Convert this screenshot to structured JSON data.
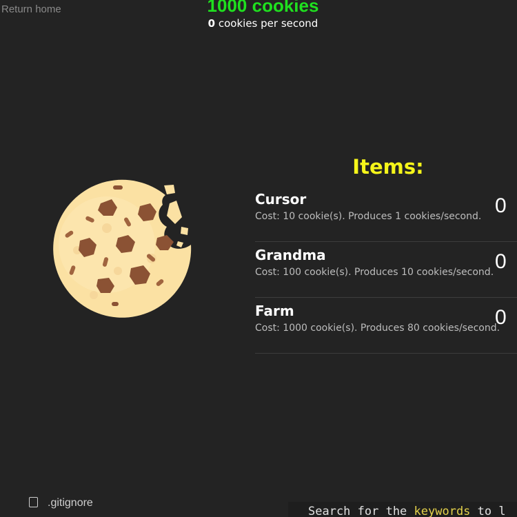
{
  "nav": {
    "return_home": "Return home"
  },
  "stats": {
    "cookies_text": "1000 cookies",
    "cps_value": "0",
    "cps_suffix": " cookies per second"
  },
  "items_title": "Items:",
  "items": [
    {
      "name": "Cursor",
      "desc": "Cost: 10 cookie(s). Produces 1 cookies/second.",
      "owned": "0"
    },
    {
      "name": "Grandma",
      "desc": "Cost: 100 cookie(s). Produces 10 cookies/second.",
      "owned": "0"
    },
    {
      "name": "Farm",
      "desc": "Cost: 1000 cookie(s). Produces 80 cookies/second.",
      "owned": "0"
    }
  ],
  "bottom": {
    "file_name": ".gitignore",
    "hint_part1": "Search for the ",
    "hint_keyword": "keywords",
    "hint_part2": " to l"
  },
  "colors": {
    "background": "#232323",
    "cookie_count": "#1fe01f",
    "items_title": "#f5f51a",
    "cookie_dough": "#fbe1a3",
    "cookie_chip": "#8b5234"
  },
  "icons": {
    "cookie": "cookie-icon",
    "file": "file-icon"
  }
}
